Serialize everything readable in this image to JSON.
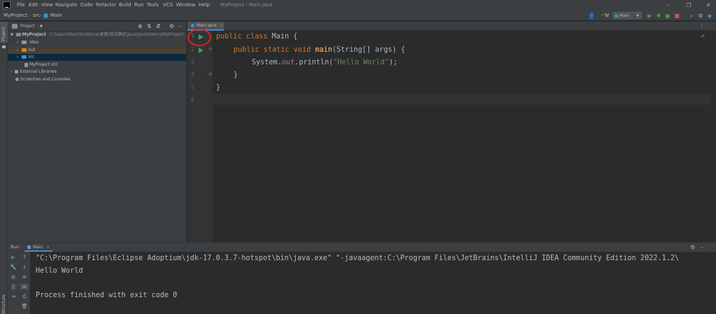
{
  "menu": [
    "File",
    "Edit",
    "View",
    "Navigate",
    "Code",
    "Refactor",
    "Build",
    "Run",
    "Tools",
    "VCS",
    "Window",
    "Help"
  ],
  "window_title": "MyProject - Main.java",
  "breadcrumbs": [
    "MyProject",
    "src",
    "Main"
  ],
  "toolbar": {
    "run_config": "Main"
  },
  "left_stripe": {
    "project": "Project",
    "structure": "Structure"
  },
  "project_panel": {
    "title": "Project",
    "tree": [
      {
        "label": "MyProject",
        "path": "C:\\Users\\Max\\OneDrive\\桌面\\程式筆記\\Java\\JavaUdemy\\MyProject"
      },
      {
        "label": ".idea"
      },
      {
        "label": "out"
      },
      {
        "label": "src"
      },
      {
        "label": "MyProject.iml"
      },
      {
        "label": "External Libraries"
      },
      {
        "label": "Scratches and Consoles"
      }
    ]
  },
  "editor": {
    "tab_label": "Main.java",
    "line_numbers": [
      "1",
      "2",
      "3",
      "4",
      "5",
      "6"
    ]
  },
  "code": {
    "l1_kw": "public class ",
    "l1_name": "Main {",
    "l2_kw": "public static void ",
    "l2_fn": "main",
    "l2_rest": "(String[] args) {",
    "l3_obj": "System.",
    "l3_out": "out",
    "l3_call": ".println(",
    "l3_str": "\"Hello World\"",
    "l3_end": ");",
    "l4": "}",
    "l5": "}"
  },
  "run_panel": {
    "label": "Run:",
    "tab": "Main",
    "output": [
      "\"C:\\Program Files\\Eclipse Adoptium\\jdk-17.0.3.7-hotspot\\bin\\java.exe\" \"-javaagent:C:\\Program Files\\JetBrains\\IntelliJ IDEA Community Edition 2022.1.2\\",
      "Hello World",
      "",
      "Process finished with exit code 0"
    ]
  },
  "colors": {
    "accent": "#4a88c7",
    "run_green": "#499c54",
    "annotation_red": "#e02020"
  }
}
